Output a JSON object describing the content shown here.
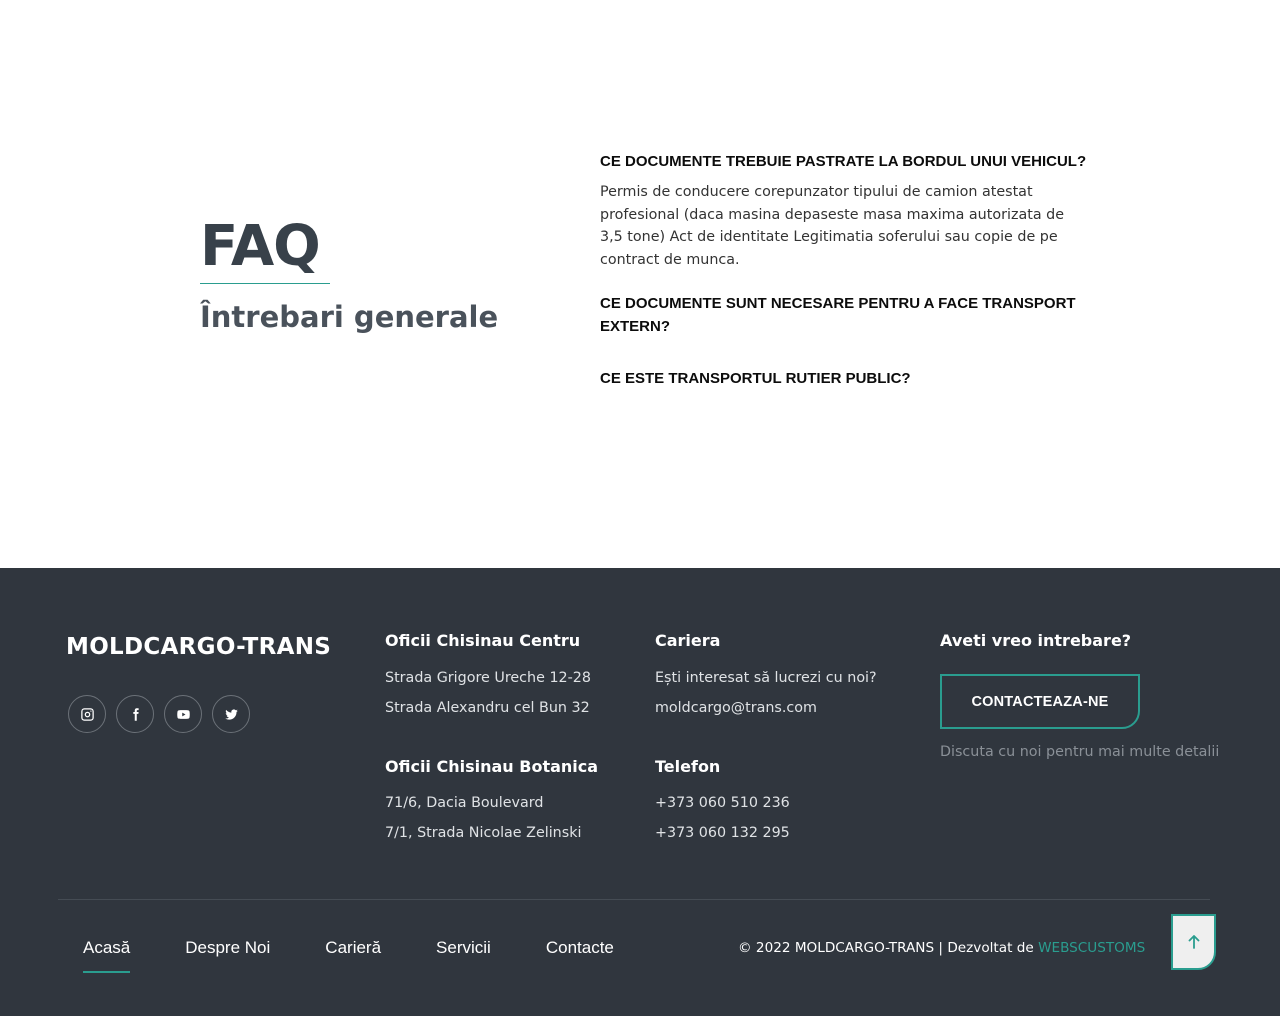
{
  "faq": {
    "title": "FAQ",
    "subtitle": "Întrebari generale",
    "items": [
      {
        "question": "CE DOCUMENTE TREBUIE PASTRATE LA BORDUL UNUI VEHICUL?",
        "answer": "Permis de conducere corepunzator tipului de camion atestat profesional (daca masina depaseste masa maxima autorizata de 3,5 tone) Act de identitate Legitimatia soferului sau copie de pe contract de munca."
      },
      {
        "question": "CE DOCUMENTE SUNT NECESARE PENTRU A FACE TRANSPORT EXTERN?"
      },
      {
        "question": "CE ESTE TRANSPORTUL RUTIER PUBLIC?"
      }
    ]
  },
  "footer": {
    "brand": "MOLDCARGO-TRANS",
    "socials": [
      "instagram-icon",
      "facebook-icon",
      "youtube-icon",
      "twitter-icon"
    ],
    "offices_center": {
      "title": "Oficii Chisinau Centru",
      "lines": [
        "Strada Grigore Ureche 12-28",
        "Strada Alexandru cel Bun 32"
      ]
    },
    "offices_botanica": {
      "title": "Oficii Chisinau Botanica",
      "lines": [
        "71/6, Dacia Boulevard",
        "7/1, Strada Nicolae Zelinski"
      ]
    },
    "career": {
      "title": "Cariera",
      "lines": [
        "Ești interesat să lucrezi cu noi?",
        "moldcargo@trans.com"
      ]
    },
    "phone": {
      "title": "Telefon",
      "lines": [
        "+373 060 510 236",
        "+373 060 132 295"
      ]
    },
    "question": {
      "title": "Aveti vreo intrebare?",
      "button": "CONTACTEAZA-NE",
      "hint": "Discuta cu noi pentru mai multe detalii"
    },
    "nav": [
      "Acasă",
      "Despre Noi",
      "Carieră",
      "Servicii",
      "Contacte"
    ],
    "nav_active": "Acasă",
    "copyright": "© 2022 MOLDCARGO-TRANS | Dezvoltat de",
    "developer": "WEBSCUSTOMS",
    "accent_color": "#2a9d8f",
    "footer_bg": "#30363e"
  }
}
